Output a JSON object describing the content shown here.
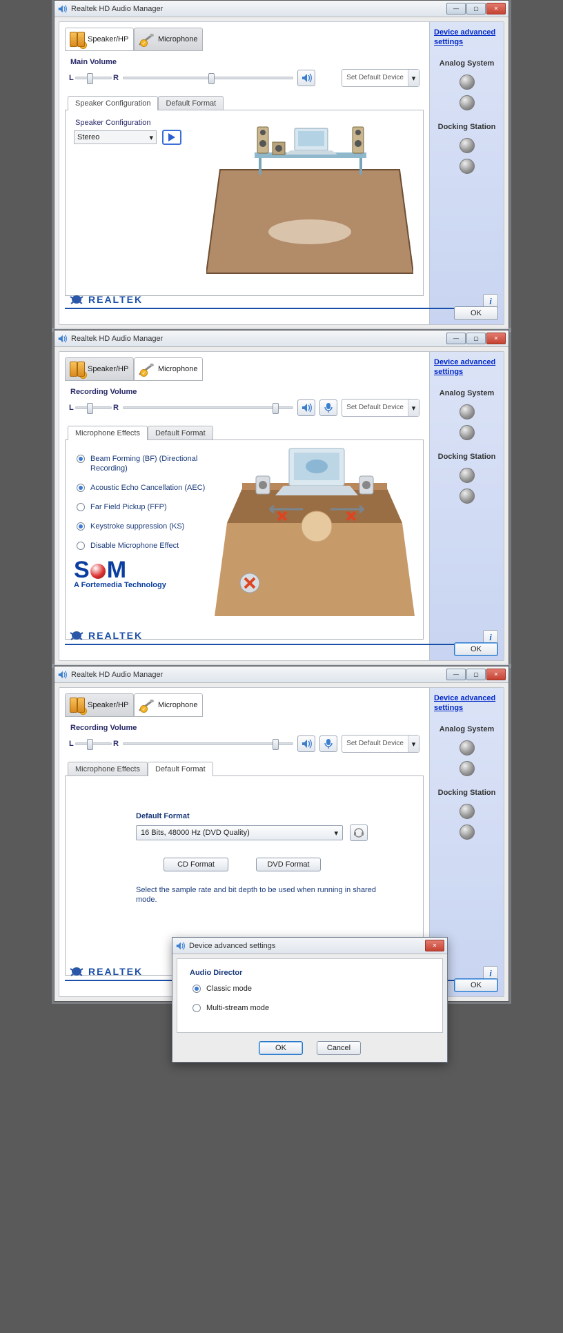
{
  "title": "Realtek HD Audio Manager",
  "link": "Device advanced settings",
  "tabs": {
    "speaker": "Speaker/HP",
    "mic": "Microphone"
  },
  "side": {
    "analog": "Analog System",
    "dock": "Docking Station"
  },
  "brand": "REALTEK",
  "ok": "OK",
  "cancel": "Cancel",
  "setdef": "Set Default Device",
  "w1": {
    "vol": "Main Volume",
    "L": "L",
    "R": "R",
    "subtabs": {
      "a": "Speaker Configuration",
      "b": "Default Format"
    },
    "cfg": "Speaker Configuration",
    "sel": "Stereo"
  },
  "w2": {
    "vol": "Recording Volume",
    "L": "L",
    "R": "R",
    "subtabs": {
      "a": "Microphone Effects",
      "b": "Default Format"
    },
    "opts": {
      "bf": "Beam Forming (BF) (Directional Recording)",
      "aec": "Acoustic Echo Cancellation (AEC)",
      "ffp": "Far Field Pickup (FFP)",
      "ks": "Keystroke suppression (KS)",
      "off": "Disable Microphone Effect"
    },
    "sam": "SAM",
    "sam_sub": "A Fortemedia Technology"
  },
  "w3": {
    "vol": "Recording Volume",
    "L": "L",
    "R": "R",
    "subtabs": {
      "a": "Microphone Effects",
      "b": "Default Format"
    },
    "lbl": "Default Format",
    "val": "16 Bits, 48000 Hz (DVD Quality)",
    "cd": "CD Format",
    "dvd": "DVD Format",
    "hint": "Select the sample rate and bit depth to be used when running in shared mode."
  },
  "dlg": {
    "title": "Device advanced settings",
    "h": "Audio Director",
    "a": "Classic mode",
    "b": "Multi-stream mode"
  }
}
